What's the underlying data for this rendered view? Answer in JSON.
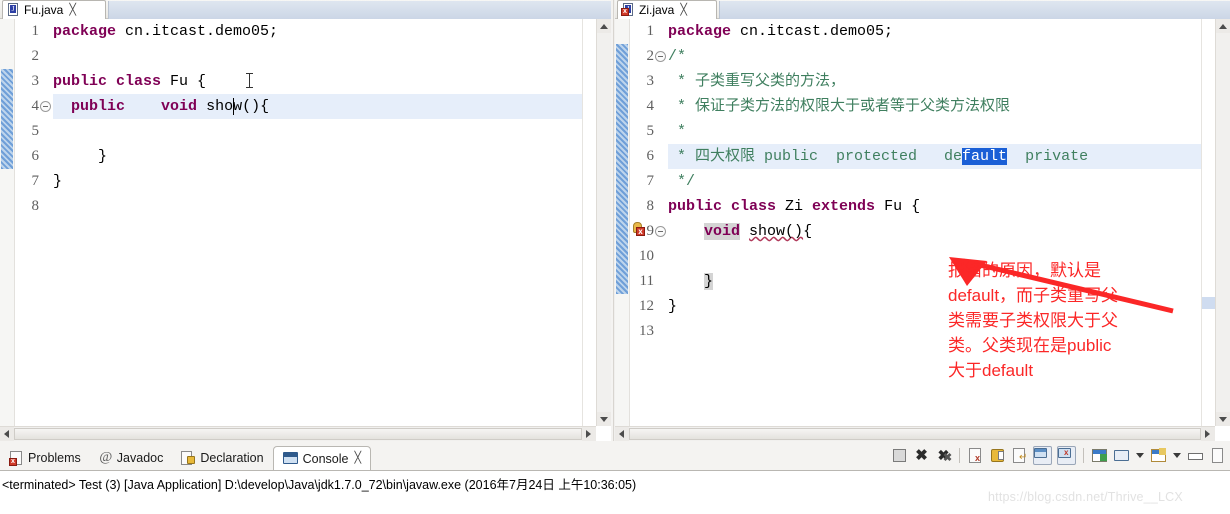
{
  "editors": [
    {
      "tab": {
        "label": "Fu.java",
        "close": "╳",
        "icon": "java-file-icon",
        "has_error": false
      },
      "lines": [
        {
          "n": "1",
          "fold": false,
          "segments": [
            {
              "t": "package ",
              "c": "kw"
            },
            {
              "t": "cn.itcast.demo05;",
              "c": "plain"
            }
          ]
        },
        {
          "n": "2",
          "fold": false,
          "segments": []
        },
        {
          "n": "3",
          "fold": false,
          "segments": [
            {
              "t": "public class ",
              "c": "kw"
            },
            {
              "t": "Fu {",
              "c": "plain"
            }
          ]
        },
        {
          "n": "4",
          "fold": true,
          "highlight": true,
          "segments": [
            {
              "t": "  ",
              "c": "plain"
            },
            {
              "t": "public",
              "c": "kw"
            },
            {
              "t": "    ",
              "c": "plain"
            },
            {
              "t": "void",
              "c": "kw"
            },
            {
              "t": " show(){",
              "c": "plain"
            }
          ]
        },
        {
          "n": "5",
          "fold": false,
          "segments": []
        },
        {
          "n": "6",
          "fold": false,
          "segments": [
            {
              "t": "     }",
              "c": "plain"
            }
          ]
        },
        {
          "n": "7",
          "fold": false,
          "segments": [
            {
              "t": "}",
              "c": "plain"
            }
          ]
        },
        {
          "n": "8",
          "fold": false,
          "segments": []
        }
      ]
    },
    {
      "tab": {
        "label": "Zi.java",
        "close": "╳",
        "icon": "java-file-error-icon",
        "has_error": true
      },
      "lines": [
        {
          "n": "1",
          "fold": false,
          "segments": [
            {
              "t": "package ",
              "c": "kw"
            },
            {
              "t": "cn.itcast.demo05;",
              "c": "plain"
            }
          ]
        },
        {
          "n": "2",
          "fold": true,
          "segments": [
            {
              "t": "/*",
              "c": "cmt"
            }
          ]
        },
        {
          "n": "3",
          "fold": false,
          "segments": [
            {
              "t": " * 子类重写父类的方法，",
              "c": "cmt"
            }
          ]
        },
        {
          "n": "4",
          "fold": false,
          "segments": [
            {
              "t": " * 保证子类方法的权限大于或者等于父类方法权限",
              "c": "cmt"
            }
          ]
        },
        {
          "n": "5",
          "fold": false,
          "segments": [
            {
              "t": " *",
              "c": "cmt"
            }
          ]
        },
        {
          "n": "6",
          "fold": false,
          "highlight": true,
          "segments": [
            {
              "t": " * 四大权限 public  protected   de",
              "c": "cmt"
            },
            {
              "t": "fault",
              "c": "sel"
            },
            {
              "t": "  private",
              "c": "cmt"
            }
          ]
        },
        {
          "n": "7",
          "fold": false,
          "segments": [
            {
              "t": " */",
              "c": "cmt"
            }
          ]
        },
        {
          "n": "8",
          "fold": false,
          "segments": [
            {
              "t": "public class ",
              "c": "kw"
            },
            {
              "t": "Zi ",
              "c": "plain"
            },
            {
              "t": "extends ",
              "c": "kw"
            },
            {
              "t": "Fu {",
              "c": "plain"
            }
          ]
        },
        {
          "n": "9",
          "fold": true,
          "error": true,
          "segments": [
            {
              "t": "    ",
              "c": "plain"
            },
            {
              "t": "void",
              "c": "kw bracket-hl"
            },
            {
              "t": " ",
              "c": "plain"
            },
            {
              "t": "show()",
              "c": "plain squiggle"
            },
            {
              "t": "{",
              "c": "plain"
            }
          ]
        },
        {
          "n": "10",
          "fold": false,
          "segments": []
        },
        {
          "n": "11",
          "fold": false,
          "segments": [
            {
              "t": "    ",
              "c": "plain"
            },
            {
              "t": "}",
              "c": "plain bracket-hl"
            }
          ]
        },
        {
          "n": "12",
          "fold": false,
          "segments": [
            {
              "t": "}",
              "c": "plain"
            }
          ]
        },
        {
          "n": "13",
          "fold": false,
          "segments": []
        }
      ]
    }
  ],
  "annotation": {
    "lines": [
      "报错的原因，默认是",
      "default，而子类重写父",
      "类需要子类权限大于父",
      "类。父类现在是public",
      "大于default"
    ],
    "color": "#fb2727"
  },
  "bottom_view": {
    "tabs": [
      {
        "label": "Problems",
        "icon": "problems-icon",
        "active": false
      },
      {
        "label": "Javadoc",
        "icon": "javadoc-icon",
        "active": false
      },
      {
        "label": "Declaration",
        "icon": "declaration-icon",
        "active": false
      },
      {
        "label": "Console",
        "icon": "console-icon",
        "active": true,
        "close": "╳"
      }
    ],
    "status": "<terminated> Test (3) [Java Application] D:\\develop\\Java\\jdk1.7.0_72\\bin\\javaw.exe (2016年7月24日 上午10:36:05)",
    "toolbar": [
      {
        "name": "terminate-icon",
        "kind": "square-grey"
      },
      {
        "name": "remove-launch-icon",
        "kind": "x"
      },
      {
        "name": "remove-all-icon",
        "kind": "xx"
      },
      {
        "name": "separator",
        "kind": "sep"
      },
      {
        "name": "clear-console-icon",
        "kind": "doc"
      },
      {
        "name": "scroll-lock-icon",
        "kind": "lock"
      },
      {
        "name": "word-wrap-icon",
        "kind": "doc2"
      },
      {
        "name": "show-console-output-icon",
        "kind": "monitor-framed"
      },
      {
        "name": "show-console-error-icon",
        "kind": "monitor-err-framed"
      },
      {
        "name": "separator2",
        "kind": "sep"
      },
      {
        "name": "pin-console-icon",
        "kind": "window-pin"
      },
      {
        "name": "display-selected-console-icon",
        "kind": "monitor"
      },
      {
        "name": "display-selected-dropdown-icon",
        "kind": "caret"
      },
      {
        "name": "open-console-icon",
        "kind": "window-new"
      },
      {
        "name": "open-console-dropdown-icon",
        "kind": "caret"
      },
      {
        "name": "minimize-icon",
        "kind": "bar"
      },
      {
        "name": "maximize-icon",
        "kind": "doc3"
      }
    ]
  },
  "watermark": "https://blog.csdn.net/Thrive__LCX"
}
